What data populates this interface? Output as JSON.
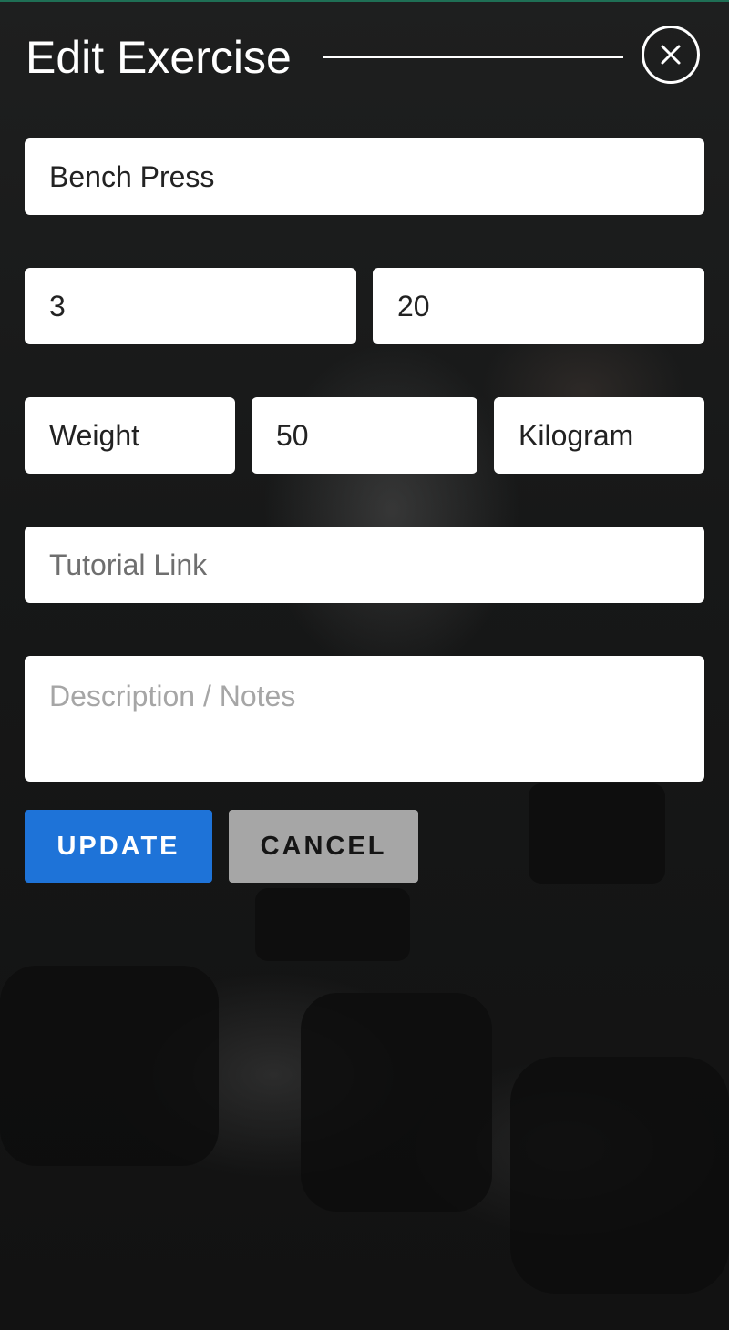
{
  "header": {
    "title": "Edit Exercise",
    "close_icon": "close-x-icon"
  },
  "form": {
    "exercise_name": "Bench Press",
    "sets": "3",
    "reps": "20",
    "measure_type": "Weight",
    "amount": "50",
    "unit": "Kilogram",
    "tutorial_link_placeholder": "Tutorial Link",
    "description_placeholder": "Description / Notes"
  },
  "actions": {
    "update_label": "UPDATE",
    "cancel_label": "CANCEL"
  },
  "colors": {
    "update": "#1e73d8",
    "cancel": "#a6a6a6",
    "field": "#ffffff"
  }
}
